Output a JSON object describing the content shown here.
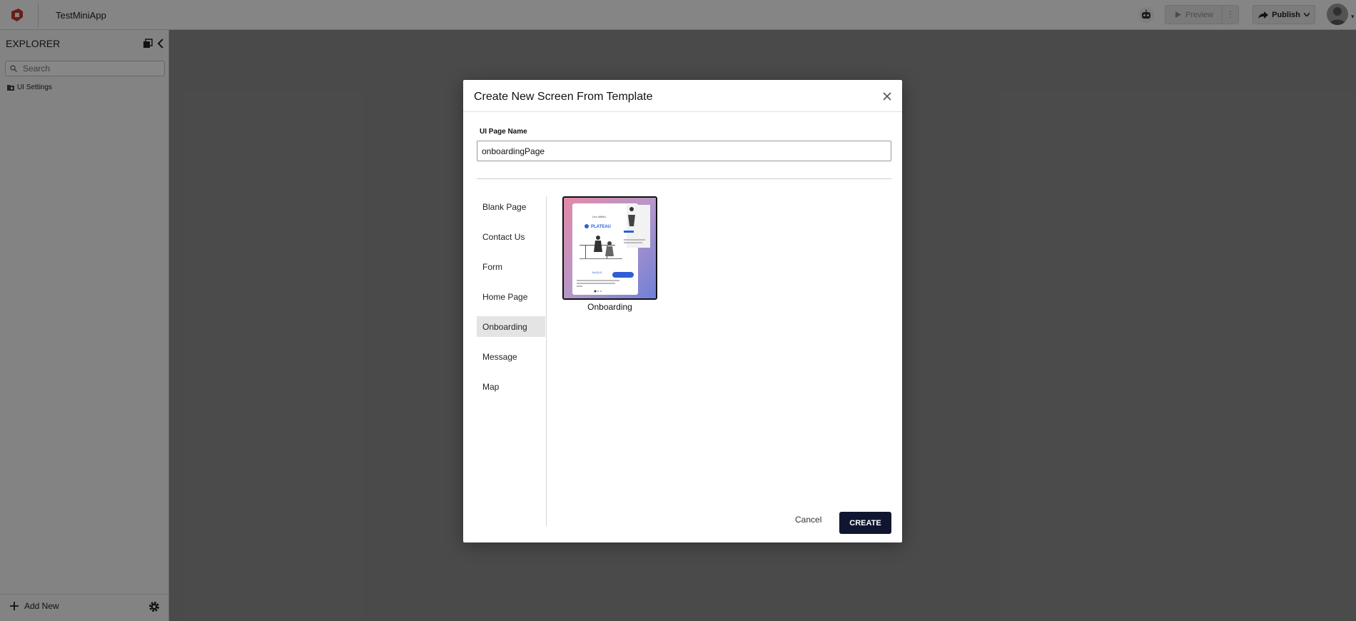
{
  "header": {
    "app_title": "TestMiniApp",
    "preview_label": "Preview",
    "publish_label": "Publish"
  },
  "sidebar": {
    "title": "EXPLORER",
    "search_placeholder": "Search",
    "tree": [
      {
        "label": "UI Settings",
        "icon": "folder-settings-icon"
      }
    ],
    "add_new_label": "Add New"
  },
  "dialog": {
    "title": "Create New Screen From Template",
    "field_label": "UI Page Name",
    "page_name_value": "onboardingPage",
    "categories": [
      {
        "label": "Blank Page"
      },
      {
        "label": "Contact Us"
      },
      {
        "label": "Form"
      },
      {
        "label": "Home Page"
      },
      {
        "label": "Onboarding",
        "selected": true
      },
      {
        "label": "Message"
      },
      {
        "label": "Map"
      }
    ],
    "templates": [
      {
        "name": "Onboarding",
        "selected": true
      }
    ],
    "cancel_label": "Cancel",
    "create_label": "CREATE"
  },
  "colors": {
    "primary_button": "#101530",
    "brand_logo": "#c0392b",
    "selected_category_bg": "#e4e4e4"
  }
}
